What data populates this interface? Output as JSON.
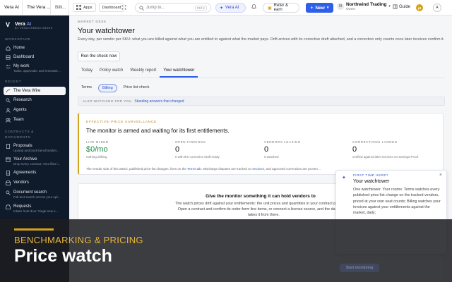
{
  "browser_tabs": [
    "Vera AI",
    "The Vera ...",
    "Billi..."
  ],
  "topbar": {
    "apps": "Apps",
    "dashboard": "Dashboard",
    "search_placeholder": "Jump to...",
    "search_shortcut": "Ctrl K",
    "vera_ai": "Vera AI",
    "refer": "Refer & earn",
    "new": "New",
    "org_initial": "N",
    "org_name": "Northwind Trading",
    "org_role": "Owner",
    "guide": "Guide",
    "coin": "pt",
    "user_initial": "A"
  },
  "sidebar": {
    "brand": "Vera",
    "brand_suffix": "AI",
    "by": "BY VENDORBENCHMARK",
    "workspace_label": "WORKSPACE",
    "workspace": [
      {
        "label": "Home"
      },
      {
        "label": "Dashboard"
      },
      {
        "label": "My work",
        "sub": "Tasks, approvals, and renewals ..."
      }
    ],
    "recent_label": "RECENT",
    "recent": [
      {
        "label": "The Vera Wire"
      },
      {
        "label": "Research"
      },
      {
        "label": "Agents"
      },
      {
        "label": "Team"
      }
    ],
    "contracts_label": "CONTRACTS & DOCUMENTS",
    "contracts": [
      {
        "label": "Proposals",
        "sub": "Upload and track benchmarkin..."
      },
      {
        "label": "Your Archive",
        "sub": "Drop every contract; Vera files i..."
      },
      {
        "label": "Agreements"
      },
      {
        "label": "Vendors"
      },
      {
        "label": "Document search",
        "sub": "Full-text search across your upl..."
      },
      {
        "label": "Requests",
        "sub": "Intake front door: triage new s..."
      }
    ]
  },
  "main": {
    "eyebrow": "MARKET DESK",
    "title": "Your watchtower",
    "description": "Every day, per vendor per SKU: what you are billed against what you are entitled to against what the market pays. Drift arrives with its corrective draft attached, and a correction only counts once later invoices confirm it.",
    "run_button": "Run the check now",
    "tabs": [
      "Today",
      "Policy watch",
      "Weekly report",
      "Your watchtower"
    ],
    "subtabs": [
      "Terms",
      "Billing",
      "Price list check"
    ],
    "also_label": "ALSO WATCHING FOR YOU",
    "also_value": "Standing answers that changed",
    "card": {
      "eyebrow": "EFFECTIVE-PRICE SURVEILLANCE",
      "heading": "The monitor is armed and waiting for its first entitlements.",
      "stats": [
        {
          "label": "LIVE BLEED",
          "value": "$0/mo",
          "sub": "nothing drifting"
        },
        {
          "label": "OPEN FINDINGS",
          "value": "0",
          "sub": "0 with the corrective draft ready"
        },
        {
          "label": "VENDORS LEAKING",
          "value": "0",
          "sub": "0 watched"
        },
        {
          "label": "CORRECTIONS LANDED",
          "value": "0",
          "sub": "verified against later invoices on Savings Proof"
        }
      ],
      "note_a": "The vendor side of this watch, published price-list changes, lives on the ",
      "note_link1": "Terms tab",
      "note_b": ". Mischarge disputes are tracked on ",
      "note_link2": "Invoices",
      "note_c": ", and approved corrections are proven ..."
    },
    "give": {
      "title": "Give the monitor something it can hold vendors to",
      "body": "The watch prices drift against your entitlements: the unit prices and quantities in your contract paperwork. Open a contract and confirm its order-form line items, or connect a license source, and the daily check takes it from there."
    }
  },
  "popover": {
    "eyebrow": "FIRST TIME HERE?",
    "title": "Your watchtower",
    "body": "One watchtower. Your rooms: Terms watches every published price-list change on the tracked vendors, priced at your own seat counts; Billing watches your invoices against your entitlements against the market, daily;"
  },
  "banner": {
    "kicker": "BENCHMARKING & PRICING",
    "title": "Price watch"
  },
  "ghost_button": "Start monitoring",
  "colors": {
    "accent": "#2f5ee8",
    "gold": "#d4a21d",
    "sidebar": "#0f1a2b",
    "green": "#1d8a4a"
  }
}
